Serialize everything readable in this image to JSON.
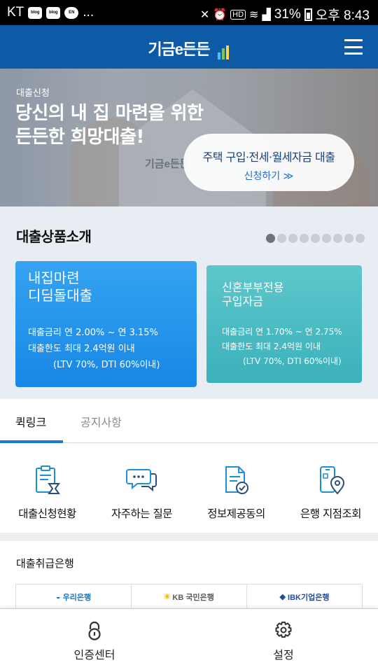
{
  "status_bar": {
    "carrier": "KT",
    "notif_icons": [
      "blog",
      "blog",
      "EN"
    ],
    "more": "...",
    "battery": "31%",
    "time": "오후 8:43"
  },
  "header": {
    "logo_text": "기금e든든",
    "menu_icon": "hamburger-menu-icon",
    "bg_color": "#0d5aa7"
  },
  "banner": {
    "eyebrow": "대출신청",
    "headline_1": "당신의 내 집 마련을 위한",
    "headline_2": "든든한 희망대출!",
    "background_logo": "기금e든든",
    "cta_title": "주택 구입·전세·월세자금 대출",
    "cta_link": "신청하기 ≫"
  },
  "products": {
    "title": "대출상품소개",
    "dot_count": 9,
    "active_dot": 0,
    "cards": [
      {
        "name_1": "내집마련",
        "name_2": "디딤돌대출",
        "rate": "대출금리 연 2.00% ~ 연 3.15%",
        "limit": "대출한도 최대 2.4억원 이내",
        "cond": "(LTV 70%, DTI 60%이내)",
        "color": "#1f8ee9"
      },
      {
        "name_1": "신혼부부전용",
        "name_2": "구입자금",
        "rate": "대출금리 연 1.70% ~ 연 2.75%",
        "limit": "대출한도 최대 2.4억원 이내",
        "cond": "(LTV 70%, DTI 60%이내)",
        "color": "#45b8c1"
      }
    ]
  },
  "tabs": [
    {
      "label": "퀵링크",
      "active": true
    },
    {
      "label": "공지사항",
      "active": false
    }
  ],
  "quick_links": [
    {
      "label": "대출신청현황",
      "icon": "clipboard-hourglass-icon"
    },
    {
      "label": "자주하는 질문",
      "icon": "chat-bubbles-icon"
    },
    {
      "label": "정보제공동의",
      "icon": "document-check-icon"
    },
    {
      "label": "은행 지점조회",
      "icon": "phone-location-icon"
    }
  ],
  "banks": {
    "title": "대출취급은행",
    "items": [
      {
        "name": "우리은행",
        "icon": "woori-logo-icon"
      },
      {
        "name": "KB 국민은행",
        "icon": "kb-star-logo-icon"
      },
      {
        "name": "IBK기업은행",
        "icon": "ibk-logo-icon"
      }
    ]
  },
  "bottom_nav": [
    {
      "label": "인증센터",
      "icon": "padlock-icon"
    },
    {
      "label": "설정",
      "icon": "gear-icon"
    }
  ],
  "accent_color": "#1c7ad8"
}
